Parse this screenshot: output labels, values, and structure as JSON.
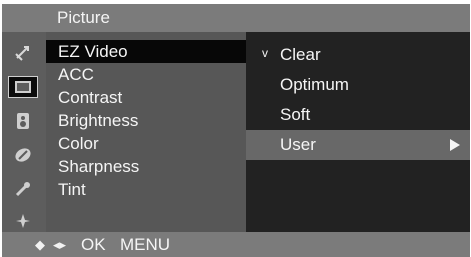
{
  "window": {
    "title": "Picture"
  },
  "icons": [
    {
      "name": "antenna-icon",
      "glyph": "✈"
    },
    {
      "name": "picture-icon",
      "glyph": ""
    },
    {
      "name": "audio-speaker-icon",
      "glyph": "◙"
    },
    {
      "name": "clock-icon",
      "glyph": "⌀"
    },
    {
      "name": "lock-icon",
      "glyph": "✎"
    },
    {
      "name": "special-menu-icon",
      "glyph": "✣"
    }
  ],
  "menu": {
    "selected_index": 0,
    "items": [
      {
        "label": "EZ Video"
      },
      {
        "label": "ACC"
      },
      {
        "label": "Contrast"
      },
      {
        "label": "Brightness"
      },
      {
        "label": "Color"
      },
      {
        "label": "Sharpness"
      },
      {
        "label": "Tint"
      }
    ]
  },
  "submenu": {
    "checked_index": 0,
    "selected_index": 3,
    "check_mark": "v",
    "items": [
      {
        "label": "Clear"
      },
      {
        "label": "Optimum"
      },
      {
        "label": "Soft"
      },
      {
        "label": "User"
      }
    ]
  },
  "footer": {
    "updown_glyph": "◆",
    "leftright_glyph": "◂▸",
    "ok_label": "OK",
    "menu_label": "MENU"
  },
  "colors": {
    "title_bar": "#7b7b7b",
    "menu_background": "#575757",
    "submenu_background": "#222222",
    "selection_black": "#070707",
    "selection_gray": "#686868"
  }
}
